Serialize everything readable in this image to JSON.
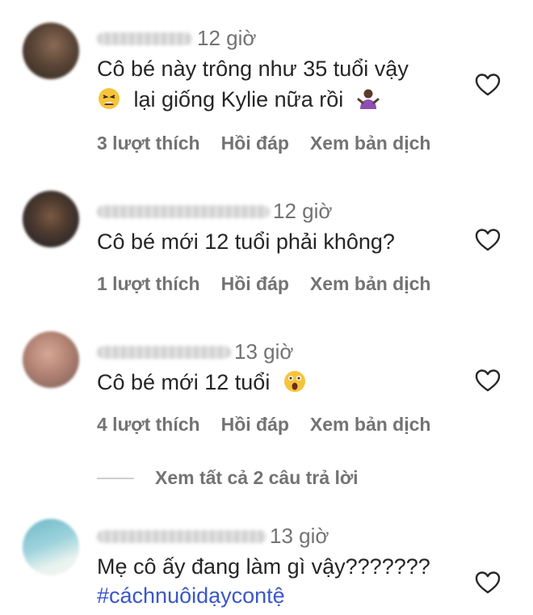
{
  "comments": [
    {
      "time": "12 giờ",
      "line1": "Cô bé này trông như 35 tuổi vậy",
      "line2": "lại giống Kylie nữa rồi",
      "likes": "3 lượt thích",
      "reply": "Hồi đáp",
      "translate": "Xem bản dịch"
    },
    {
      "time": "12 giờ",
      "line1": "Cô bé mới 12 tuổi phải không?",
      "likes": "1 lượt thích",
      "reply": "Hồi đáp",
      "translate": "Xem bản dịch"
    },
    {
      "time": "13 giờ",
      "line1": "Cô bé mới 12 tuổi",
      "likes": "4 lượt thích",
      "reply": "Hồi đáp",
      "translate": "Xem bản dịch"
    },
    {
      "time": "13 giờ",
      "line1": "Mẹ cô ấy đang làm gì vậy???????",
      "hashtag": "#cáchnuôidạycontệ"
    }
  ],
  "view_replies": "Xem tất cả 2 câu trả lời",
  "icons": [
    "tired-face-emoji",
    "person-shrugging-emoji",
    "astonished-face-emoji",
    "heart-outline-icon"
  ]
}
